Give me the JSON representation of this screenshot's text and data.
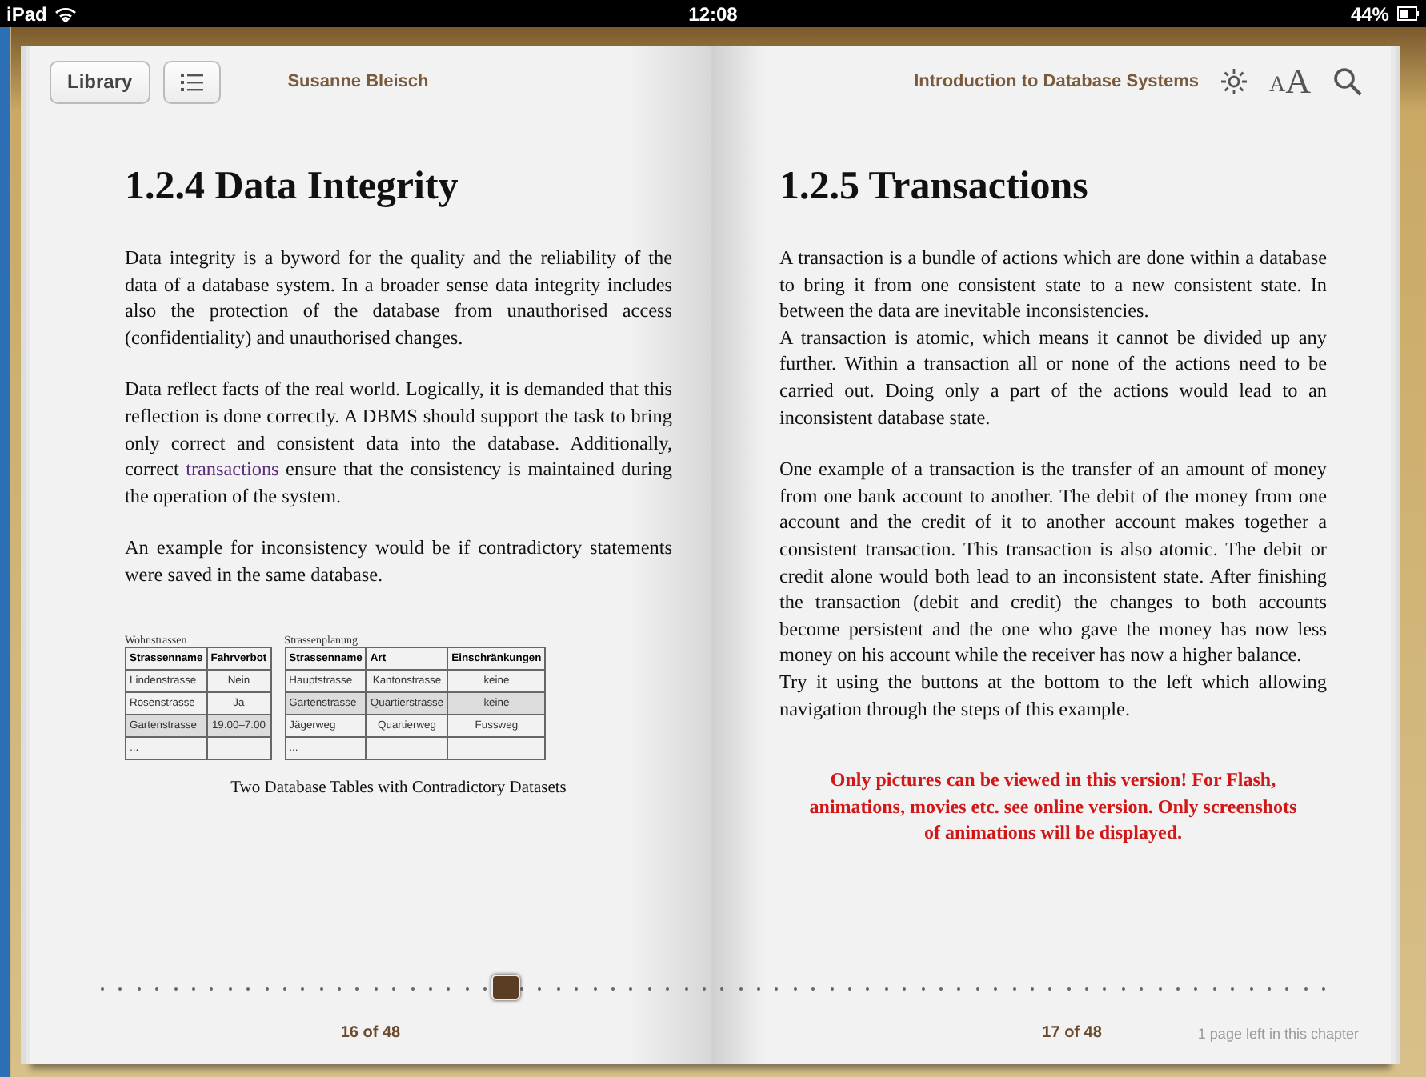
{
  "status_bar": {
    "device": "iPad",
    "time": "12:08",
    "battery": "44%"
  },
  "toolbar": {
    "library": "Library",
    "author": "Susanne Bleisch",
    "book_title": "Introduction to Database Systems",
    "font_small": "A",
    "font_large": "A"
  },
  "left_page": {
    "heading": "1.2.4 Data Integrity",
    "blocks": [
      {
        "kind": "paragraph",
        "text": "Data integrity is a byword for the quality and the reliability of the data of a database system. In a broader sense data integrity includes also the protection of the database from unauthorised access (confidentiality) and unauthorised changes."
      },
      {
        "kind": "paragraph_link",
        "before": "Data reflect facts of the real world. Logically, it is demanded that this reflection is done correctly. A DBMS should support the task to bring only correct and consistent data into the database. Additionally, correct",
        "link": "transactions",
        "after": "ensure that the consistency is maintained during the operation of the system."
      },
      {
        "kind": "paragraph",
        "text": "An example for inconsistency would be if contradictory statements were saved in the same database."
      }
    ],
    "figure": {
      "tables": [
        {
          "name": "Wohnstrassen",
          "columns": [
            "Strassenname",
            "Fahrverbot"
          ],
          "rows": [
            {
              "cells": [
                "Lindenstrasse",
                "Nein"
              ],
              "highlighted": false
            },
            {
              "cells": [
                "Rosenstrasse",
                "Ja"
              ],
              "highlighted": false
            },
            {
              "cells": [
                "Gartenstrasse",
                "19.00–7.00"
              ],
              "highlighted": true
            },
            {
              "cells": [
                "...",
                ""
              ],
              "highlighted": false
            }
          ]
        },
        {
          "name": "Strassenplanung",
          "columns": [
            "Strassenname",
            "Art",
            "Einschränkungen"
          ],
          "rows": [
            {
              "cells": [
                "Hauptstrasse",
                "Kantonstrasse",
                "keine"
              ],
              "highlighted": false
            },
            {
              "cells": [
                "Gartenstrasse",
                "Quartierstrasse",
                "keine"
              ],
              "highlighted": true
            },
            {
              "cells": [
                "Jägerweg",
                "Quartierweg",
                "Fussweg"
              ],
              "highlighted": false
            },
            {
              "cells": [
                "...",
                "",
                ""
              ],
              "highlighted": false
            }
          ]
        }
      ],
      "caption": "Two Database Tables with Contradictory Datasets"
    },
    "page_number": "16 of 48"
  },
  "right_page": {
    "heading": "1.2.5 Transactions",
    "blocks": [
      {
        "kind": "paragraph",
        "text": "A transaction is a bundle of actions which are done within a database to bring it from one consistent state to a new consistent state. In between the data are inevitable inconsistencies."
      },
      {
        "kind": "paragraph_tight",
        "text": "A transaction is atomic, which means it cannot be divided up any further. Within a transaction all or none of the actions need to be carried out. Doing only a part of the actions would lead to an inconsistent database state."
      },
      {
        "kind": "paragraph",
        "text": "One example of a transaction is the transfer of an amount of money from one bank account to another. The debit of the money from one account and the credit of it to another account makes together a consistent transaction. This transaction is also atomic. The debit or credit alone would both lead to an inconsistent state. After finishing the transaction (debit and credit) the changes to both accounts become persistent and the one who gave the money has now less money on his account while the receiver has now a higher balance."
      },
      {
        "kind": "paragraph_tight",
        "text": "Try it using the buttons at the bottom to the left which allowing navigation through the steps of this example."
      },
      {
        "kind": "notice",
        "text": "Only pictures can be viewed in this version! For Flash, animations, movies etc. see online version. Only screenshots of animations will be displayed."
      }
    ],
    "page_number": "17 of 48",
    "chapter_note": "1 page left in this chapter"
  },
  "scrubber": {
    "level": 0.33
  }
}
